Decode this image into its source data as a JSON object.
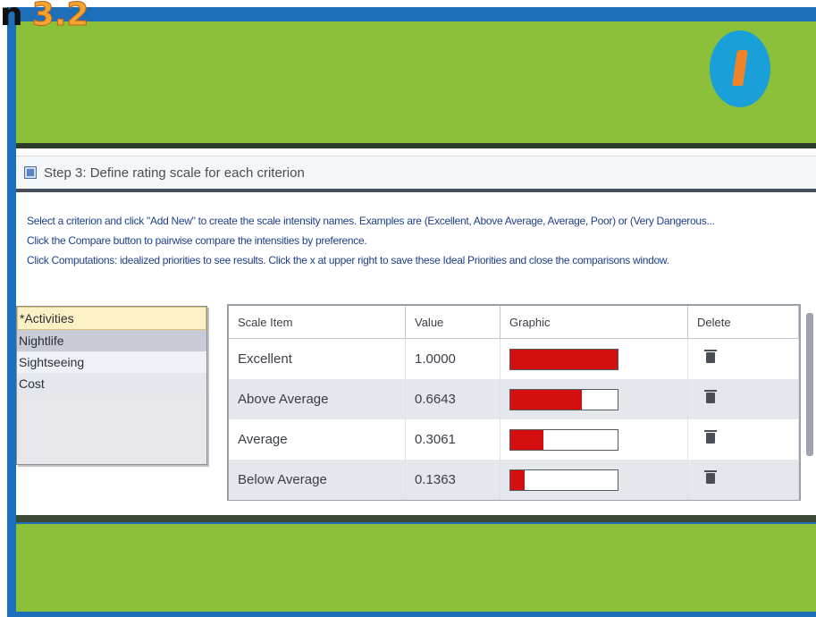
{
  "slide": {
    "title_prefix": "n",
    "title_number": "3.2"
  },
  "colors": {
    "frame": "#1c6fb8",
    "band": "#8cc03a",
    "bar_fill": "#d40f0f"
  },
  "step": {
    "label": "Step 3: Define rating scale for each criterion"
  },
  "instructions": [
    "Select a criterion and click \"Add New\" to create the scale intensity names. Examples are (Excellent, Above Average, Average, Poor) or (Very Dangerous...",
    "Click the Compare button to pairwise compare the intensities by preference.",
    "Click Computations: idealized priorities to see results. Click the x at upper right to save these Ideal Priorities and close the comparisons window."
  ],
  "criteria": [
    {
      "label": "*Activities"
    },
    {
      "label": "Nightlife"
    },
    {
      "label": "Sightseeing"
    },
    {
      "label": "Cost"
    }
  ],
  "table": {
    "headers": {
      "name": "Scale Item",
      "value": "Value",
      "graphic": "Graphic",
      "delete": "Delete"
    },
    "rows": [
      {
        "name": "Excellent",
        "value": "1.0000",
        "fraction": 1.0
      },
      {
        "name": "Above Average",
        "value": "0.6643",
        "fraction": 0.6643
      },
      {
        "name": "Average",
        "value": "0.3061",
        "fraction": 0.3061
      },
      {
        "name": "Below Average",
        "value": "0.1363",
        "fraction": 0.1363
      }
    ]
  },
  "icons": {
    "step": "step-toggle-icon",
    "logo": "brand-logo-icon",
    "delete": "trash-icon"
  }
}
